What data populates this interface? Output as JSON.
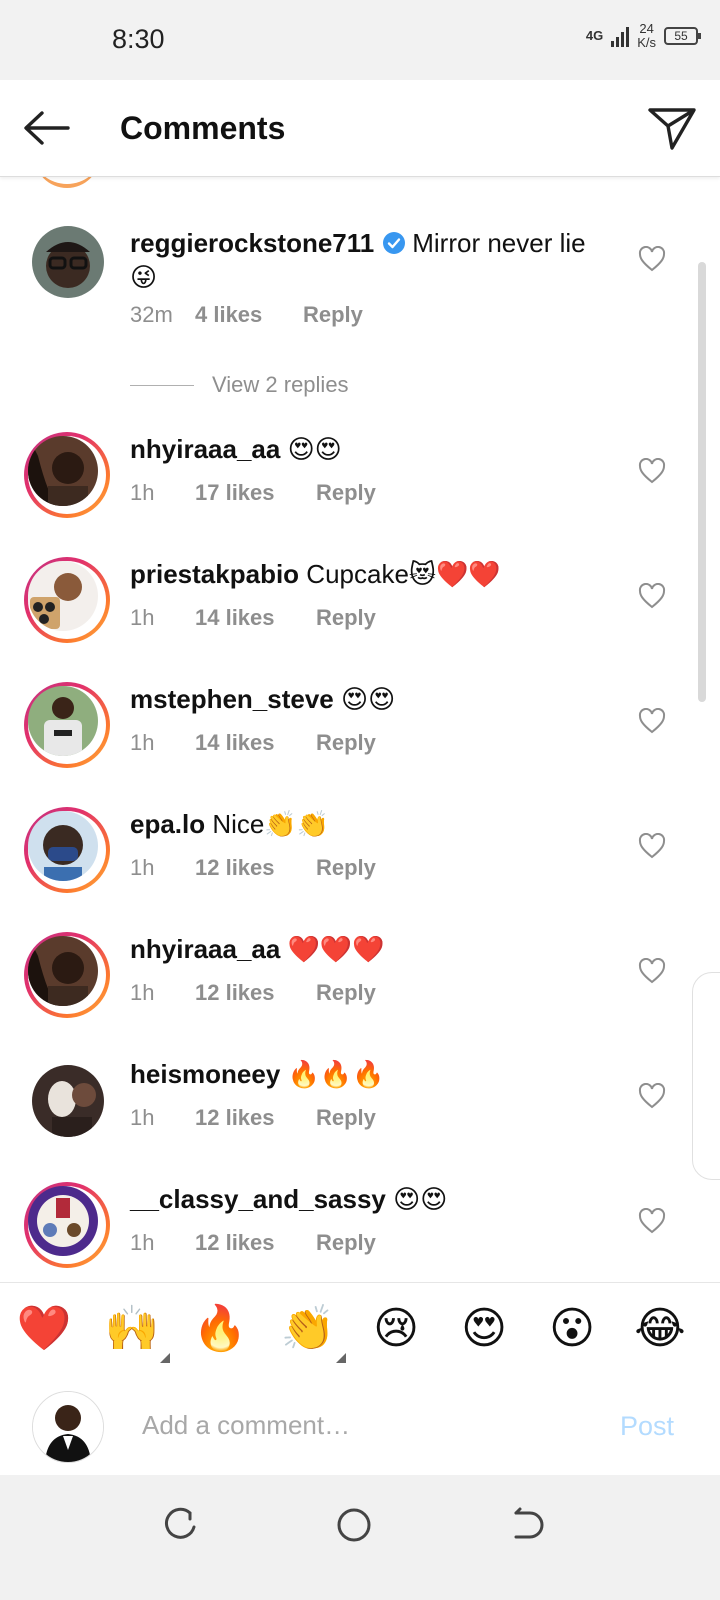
{
  "status_bar": {
    "time": "8:30",
    "network": "4G",
    "speed_value": "24",
    "speed_unit": "K/s",
    "battery": "55"
  },
  "header": {
    "title": "Comments"
  },
  "comments": [
    {
      "username": "reggierockstone711",
      "verified": true,
      "text": "Mirror never lie 😜",
      "time": "32m",
      "likes": "4 likes",
      "reply": "Reply"
    },
    {
      "username": "nhyiraaa_aa",
      "text": "😍😍",
      "time": "1h",
      "likes": "17 likes",
      "reply": "Reply"
    },
    {
      "username": "priestakpabio",
      "text": "Cupcake😻❤️❤️",
      "time": "1h",
      "likes": "14 likes",
      "reply": "Reply"
    },
    {
      "username": "mstephen_steve",
      "text": "😍😍",
      "time": "1h",
      "likes": "14 likes",
      "reply": "Reply"
    },
    {
      "username": "epa.lo",
      "text": "Nice👏👏",
      "time": "1h",
      "likes": "12 likes",
      "reply": "Reply"
    },
    {
      "username": "nhyiraaa_aa",
      "text": "❤️❤️❤️",
      "time": "1h",
      "likes": "12 likes",
      "reply": "Reply"
    },
    {
      "username": "heismoneey",
      "text": "🔥🔥🔥",
      "time": "1h",
      "likes": "12 likes",
      "reply": "Reply"
    },
    {
      "username": "__classy_and_sassy",
      "text": "😍😍",
      "time": "1h",
      "likes": "12 likes",
      "reply": "Reply"
    }
  ],
  "view_replies": "View 2 replies",
  "emoji_bar": [
    "❤️",
    "🙌",
    "🔥",
    "👏",
    "😢",
    "😍",
    "😮",
    "😂"
  ],
  "comment_input": {
    "placeholder": "Add a comment…",
    "post_label": "Post"
  },
  "colors": {
    "accent": "#3897f0",
    "post_disabled": "#b3dbff",
    "meta_gray": "#8e8e8e"
  }
}
